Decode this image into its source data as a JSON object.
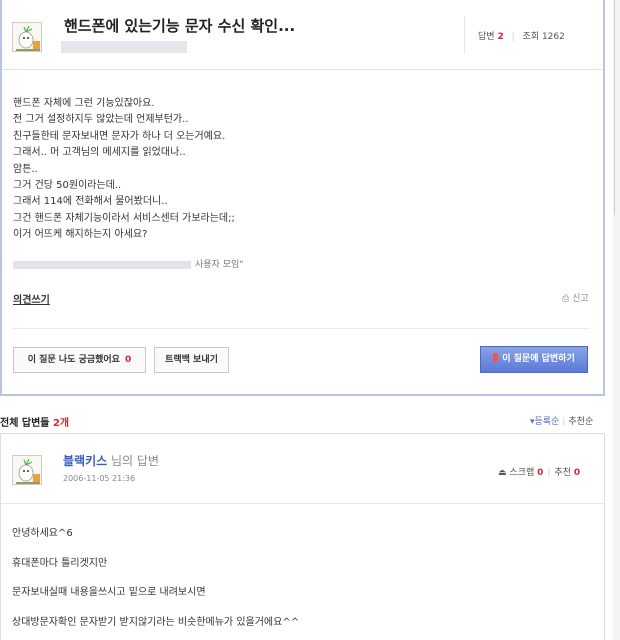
{
  "question": {
    "title": "핸드폰에 있는기능 문자 수신 확인...",
    "stats": {
      "answers_label": "답변",
      "answers": "2",
      "views_label": "조회",
      "views": "1262"
    },
    "body": [
      "핸드폰 자체에 그런 기능있잖아요.",
      "전 그거 설정하지두 않았는데 언제부턴가..",
      "친구들한테 문자보내면 문자가 하나 더 오는거예요.",
      "그래서.. 머 고객님의 메세지를 읽었대나..",
      "암튼..",
      "그거 건당 50원이라는데..",
      "그래서 114에 전화해서 물어봤더니..",
      "그건 핸드폰 자체기능이라서 서비스센터 가보라는데;;",
      "이거 어뜨케 해지하는지 아세요?"
    ],
    "source_suffix": "사용자 모임\"",
    "opinion_label": "의견쓰기",
    "report_label": "신고",
    "curious_label": "이 질문 나도 궁금했어요",
    "curious_count": "0",
    "trackback_label": "트랙백 보내기",
    "answer_button_label": "이 질문에 답변하기"
  },
  "answers_header": {
    "prefix": "전체 답변들",
    "count": "2개"
  },
  "sort": {
    "by_registration": "▾등록순",
    "by_recommendation": "추천순"
  },
  "answer": {
    "author": "블랙키스",
    "author_suffix": "님의 답변",
    "date": "2006-11-05 21:36",
    "scrap_label": "스크랩",
    "scrap_count": "0",
    "recommend_label": "추천",
    "recommend_count": "0",
    "body": [
      "안녕하세요^6",
      "휴대폰마다 틀리겟지만",
      "문자보내실때 내용을쓰시고 밑으로 내려보시면",
      "상대방문자확인 문자받기 받지않기라는 비슷한메뉴가 있을거에요^^"
    ]
  },
  "colors": {
    "accent_blue": "#5b79d6",
    "count_red": "#dd2233",
    "question_border": "#b9c3e6"
  },
  "icons": {
    "avatar": "cartoon-character-icon",
    "report": "printer-icon",
    "scrap": "scrap-icon",
    "answer_pen": "pencil-icon"
  }
}
